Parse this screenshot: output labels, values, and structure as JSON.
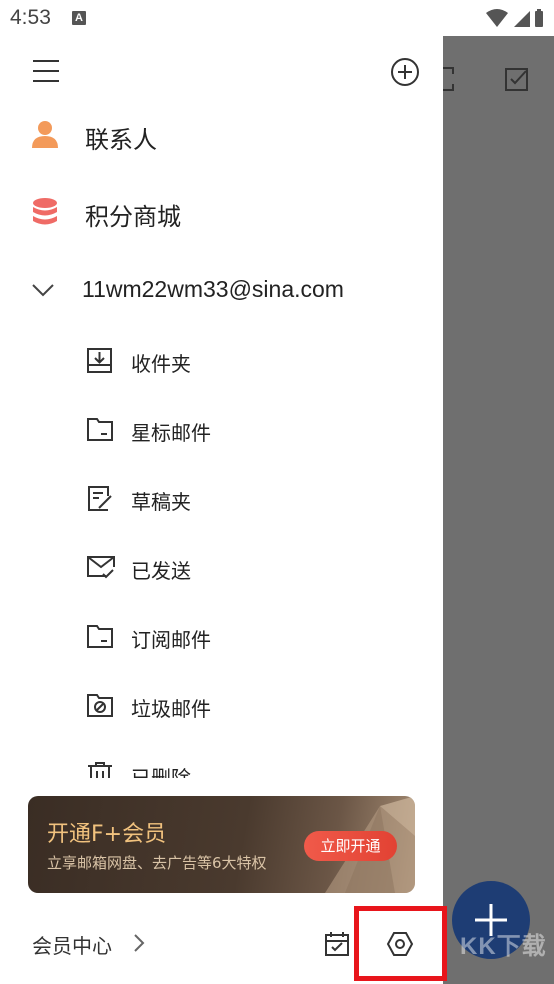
{
  "status_bar": {
    "time": "4:53",
    "notification_icon": "A"
  },
  "drawer": {
    "top_items": [
      {
        "label": "联系人",
        "icon": "contacts-person-icon",
        "color": "#f39a5a"
      },
      {
        "label": "积分商城",
        "icon": "points-mall-stack-icon",
        "color": "#ef6b66"
      }
    ],
    "account": {
      "email": "11wm22wm33@sina.com",
      "expanded": true
    },
    "folders": [
      {
        "label": "收件夹",
        "icon": "inbox-icon"
      },
      {
        "label": "星标邮件",
        "icon": "starred-folder-icon"
      },
      {
        "label": "草稿夹",
        "icon": "drafts-icon"
      },
      {
        "label": "已发送",
        "icon": "sent-icon"
      },
      {
        "label": "订阅邮件",
        "icon": "subscription-folder-icon"
      },
      {
        "label": "垃圾邮件",
        "icon": "spam-folder-icon"
      },
      {
        "label": "已删除",
        "icon": "trash-icon"
      }
    ],
    "promo": {
      "title": "开通F+会员",
      "subtitle": "立享邮箱网盘、去广告等6大特权",
      "button": "立即开通"
    },
    "bottom": {
      "vip_center": "会员中心"
    }
  },
  "background": {
    "watermark": "KK下载"
  },
  "colors": {
    "accent_red": "#e8151b",
    "fab": "#1e3d74",
    "promo_gold": "#f1c27e"
  }
}
